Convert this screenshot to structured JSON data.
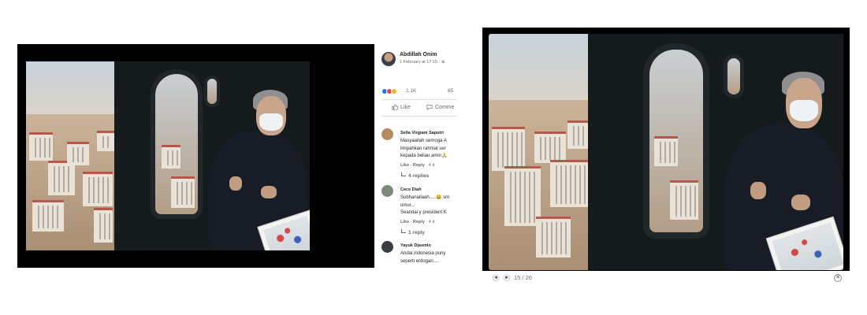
{
  "post": {
    "author_name": "Abdillah Onim",
    "time": "1 February at 17:15 · ",
    "reaction_count": "1.1K",
    "comment_count": "65",
    "like_label": "Like",
    "comment_label": "Comme"
  },
  "comments": [
    {
      "name": "Sella Virgiani Saputri",
      "text": "Masyaallah semoga A\nlimpahkan rahmat ser\nkepada beliau amin🙏",
      "like": "Like",
      "reply": "Reply",
      "time": "4 d",
      "replies": "4 replies",
      "avatar_color": "#b58a5e"
    },
    {
      "name": "Cece Diah",
      "text": "Subhanallaah.....😀 sm\numur...\nSeandai y president K",
      "like": "Like",
      "reply": "Reply",
      "time": "4 d",
      "replies": "1 reply",
      "avatar_color": "#7d8a7a"
    },
    {
      "name": "Yayuk Djasmin",
      "text": "Andai indonesia puny\nseperti erdogan....",
      "avatar_color": "#3b3e42"
    }
  ],
  "lightbox": {
    "counter": "15 / 26",
    "prev_icon": "◂",
    "next_icon": "▸",
    "close_icon": "✕"
  },
  "colors": {
    "fb_blue": "#1877f2",
    "love_red": "#f33e58",
    "care_yellow": "#f7b125",
    "meta_gray": "#65676b"
  }
}
